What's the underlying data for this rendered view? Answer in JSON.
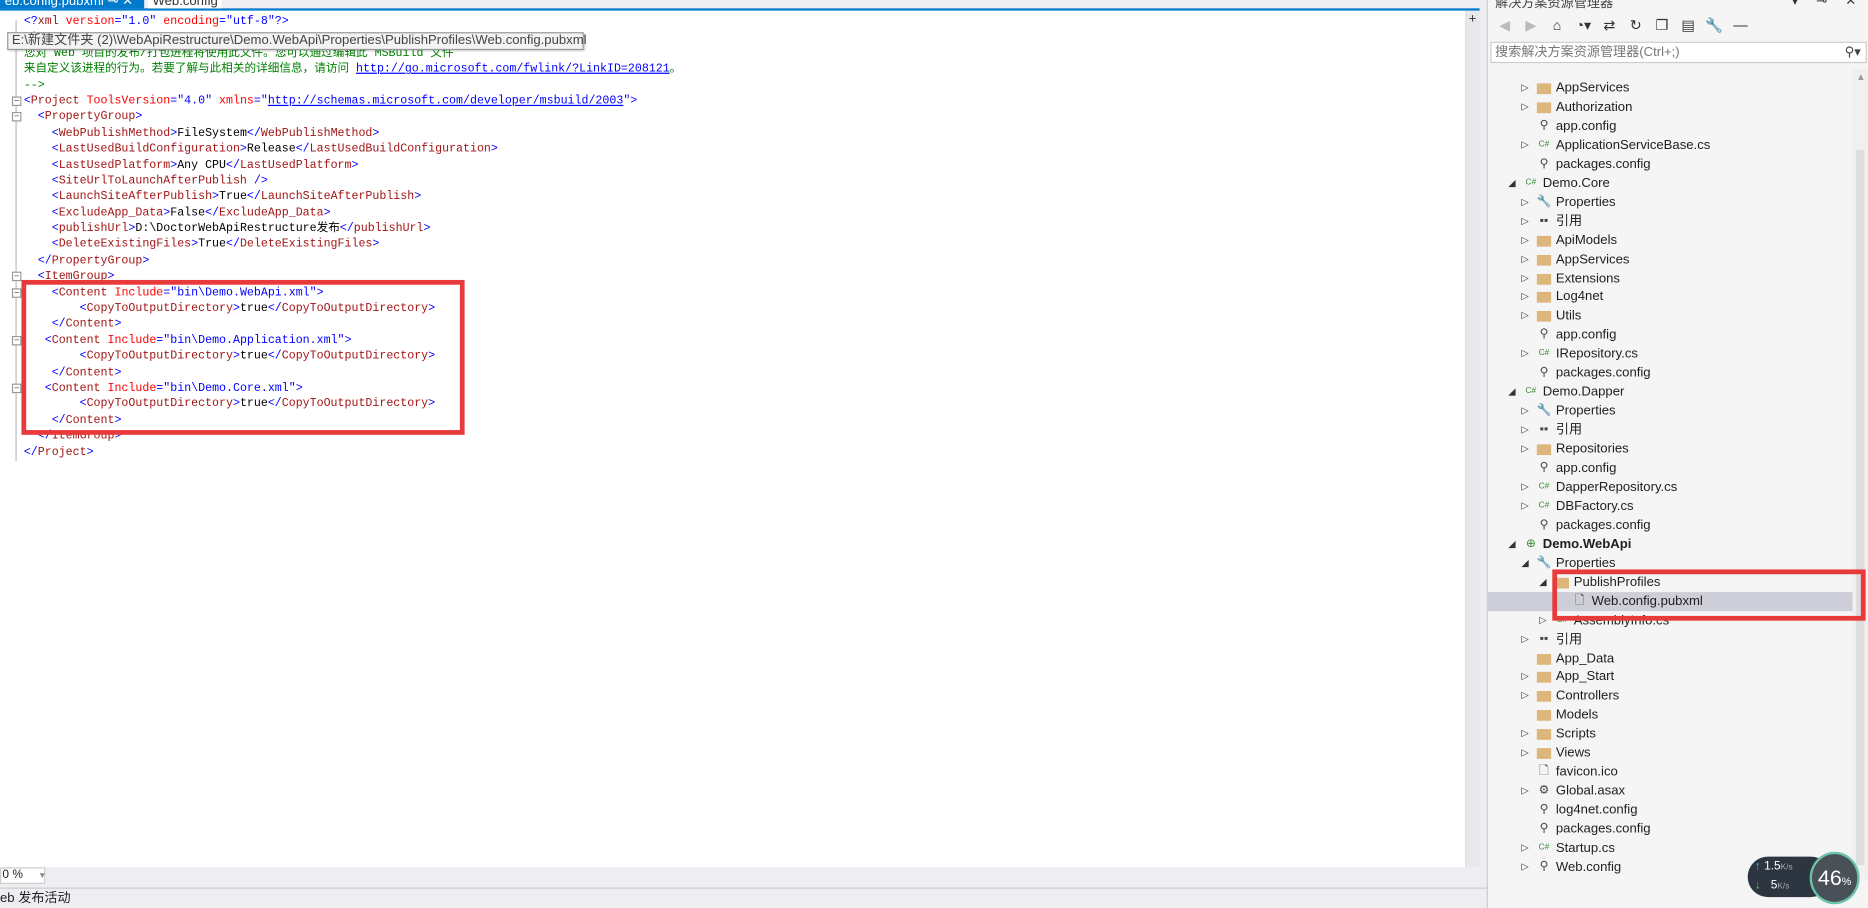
{
  "tabs": [
    {
      "label": "eb.config.pubxml",
      "active": true,
      "pin": "⊸",
      "close": "✕"
    },
    {
      "label": "Web.config",
      "active": false
    }
  ],
  "tooltip": "E:\\新建文件夹 (2)\\WebApiRestructure\\Demo.WebApi\\Properties\\PublishProfiles\\Web.config.pubxml",
  "code_lines": [
    [
      [
        "pb",
        "<?"
      ],
      [
        "el",
        "xml"
      ],
      [
        "at",
        " version"
      ],
      [
        "pb",
        "=\"1.0\""
      ],
      [
        "at",
        " encoding"
      ],
      [
        "pb",
        "=\"utf-8\"?>"
      ]
    ],
    [
      [
        "cm",
        "<!--"
      ]
    ],
    [
      [
        "cm",
        "您对 Web 项目的发布/打包进程将使用此文件。您可以通过编辑此 MSBuild 文件"
      ]
    ],
    [
      [
        "cm",
        "来自定义该进程的行为。若要了解与此相关的详细信息，请访问 "
      ],
      [
        "ln",
        "http://go.microsoft.com/fwlink/?LinkID=208121"
      ],
      [
        "cm",
        "。"
      ]
    ],
    [
      [
        "cm",
        "-->"
      ]
    ],
    [
      [
        "pb",
        "<"
      ],
      [
        "el",
        "Project"
      ],
      [
        "at",
        " ToolsVersion"
      ],
      [
        "pb",
        "=\"4.0\""
      ],
      [
        "at",
        " xmlns"
      ],
      [
        "pb",
        "=\""
      ],
      [
        "ln",
        "http://schemas.microsoft.com/developer/msbuild/2003"
      ],
      [
        "pb",
        "\">"
      ]
    ],
    [
      [
        "tx",
        "  "
      ],
      [
        "pb",
        "<"
      ],
      [
        "el",
        "PropertyGroup"
      ],
      [
        "pb",
        ">"
      ]
    ],
    [
      [
        "tx",
        "    "
      ],
      [
        "pb",
        "<"
      ],
      [
        "el",
        "WebPublishMethod"
      ],
      [
        "pb",
        ">"
      ],
      [
        "tx",
        "FileSystem"
      ],
      [
        "pb",
        "</"
      ],
      [
        "el",
        "WebPublishMethod"
      ],
      [
        "pb",
        ">"
      ]
    ],
    [
      [
        "tx",
        "    "
      ],
      [
        "pb",
        "<"
      ],
      [
        "el",
        "LastUsedBuildConfiguration"
      ],
      [
        "pb",
        ">"
      ],
      [
        "tx",
        "Release"
      ],
      [
        "pb",
        "</"
      ],
      [
        "el",
        "LastUsedBuildConfiguration"
      ],
      [
        "pb",
        ">"
      ]
    ],
    [
      [
        "tx",
        "    "
      ],
      [
        "pb",
        "<"
      ],
      [
        "el",
        "LastUsedPlatform"
      ],
      [
        "pb",
        ">"
      ],
      [
        "tx",
        "Any CPU"
      ],
      [
        "pb",
        "</"
      ],
      [
        "el",
        "LastUsedPlatform"
      ],
      [
        "pb",
        ">"
      ]
    ],
    [
      [
        "tx",
        "    "
      ],
      [
        "pb",
        "<"
      ],
      [
        "el",
        "SiteUrlToLaunchAfterPublish"
      ],
      [
        "pb",
        " />"
      ]
    ],
    [
      [
        "tx",
        "    "
      ],
      [
        "pb",
        "<"
      ],
      [
        "el",
        "LaunchSiteAfterPublish"
      ],
      [
        "pb",
        ">"
      ],
      [
        "tx",
        "True"
      ],
      [
        "pb",
        "</"
      ],
      [
        "el",
        "LaunchSiteAfterPublish"
      ],
      [
        "pb",
        ">"
      ]
    ],
    [
      [
        "tx",
        "    "
      ],
      [
        "pb",
        "<"
      ],
      [
        "el",
        "ExcludeApp_Data"
      ],
      [
        "pb",
        ">"
      ],
      [
        "tx",
        "False"
      ],
      [
        "pb",
        "</"
      ],
      [
        "el",
        "ExcludeApp_Data"
      ],
      [
        "pb",
        ">"
      ]
    ],
    [
      [
        "tx",
        "    "
      ],
      [
        "pb",
        "<"
      ],
      [
        "el",
        "publishUrl"
      ],
      [
        "pb",
        ">"
      ],
      [
        "tx",
        "D:\\DoctorWebApiRestructure发布"
      ],
      [
        "pb",
        "</"
      ],
      [
        "el",
        "publishUrl"
      ],
      [
        "pb",
        ">"
      ]
    ],
    [
      [
        "tx",
        "    "
      ],
      [
        "pb",
        "<"
      ],
      [
        "el",
        "DeleteExistingFiles"
      ],
      [
        "pb",
        ">"
      ],
      [
        "tx",
        "True"
      ],
      [
        "pb",
        "</"
      ],
      [
        "el",
        "DeleteExistingFiles"
      ],
      [
        "pb",
        ">"
      ]
    ],
    [
      [
        "tx",
        "  "
      ],
      [
        "pb",
        "</"
      ],
      [
        "el",
        "PropertyGroup"
      ],
      [
        "pb",
        ">"
      ]
    ],
    [
      [
        "tx",
        "  "
      ],
      [
        "pb",
        "<"
      ],
      [
        "el",
        "ItemGroup"
      ],
      [
        "pb",
        ">"
      ]
    ],
    [
      [
        "tx",
        "    "
      ],
      [
        "pb",
        "<"
      ],
      [
        "el",
        "Content"
      ],
      [
        "at",
        " Include"
      ],
      [
        "pb",
        "=\"bin\\Demo.WebApi.xml\">"
      ]
    ],
    [
      [
        "tx",
        "        "
      ],
      [
        "pb",
        "<"
      ],
      [
        "el",
        "CopyToOutputDirectory"
      ],
      [
        "pb",
        ">"
      ],
      [
        "tx",
        "true"
      ],
      [
        "pb",
        "</"
      ],
      [
        "el",
        "CopyToOutputDirectory"
      ],
      [
        "pb",
        ">"
      ]
    ],
    [
      [
        "tx",
        "    "
      ],
      [
        "pb",
        "</"
      ],
      [
        "el",
        "Content"
      ],
      [
        "pb",
        ">"
      ]
    ],
    [
      [
        "tx",
        "   "
      ],
      [
        "pb",
        "<"
      ],
      [
        "el",
        "Content"
      ],
      [
        "at",
        " Include"
      ],
      [
        "pb",
        "=\"bin\\Demo.Application.xml\">"
      ]
    ],
    [
      [
        "tx",
        "        "
      ],
      [
        "pb",
        "<"
      ],
      [
        "el",
        "CopyToOutputDirectory"
      ],
      [
        "pb",
        ">"
      ],
      [
        "tx",
        "true"
      ],
      [
        "pb",
        "</"
      ],
      [
        "el",
        "CopyToOutputDirectory"
      ],
      [
        "pb",
        ">"
      ]
    ],
    [
      [
        "tx",
        "    "
      ],
      [
        "pb",
        "</"
      ],
      [
        "el",
        "Content"
      ],
      [
        "pb",
        ">"
      ]
    ],
    [
      [
        "tx",
        "   "
      ],
      [
        "pb",
        "<"
      ],
      [
        "el",
        "Content"
      ],
      [
        "at",
        " Include"
      ],
      [
        "pb",
        "=\"bin\\Demo.Core.xml\">"
      ]
    ],
    [
      [
        "tx",
        "        "
      ],
      [
        "pb",
        "<"
      ],
      [
        "el",
        "CopyToOutputDirectory"
      ],
      [
        "pb",
        ">"
      ],
      [
        "tx",
        "true"
      ],
      [
        "pb",
        "</"
      ],
      [
        "el",
        "CopyToOutputDirectory"
      ],
      [
        "pb",
        ">"
      ]
    ],
    [
      [
        "tx",
        "    "
      ],
      [
        "pb",
        "</"
      ],
      [
        "el",
        "Content"
      ],
      [
        "pb",
        ">"
      ]
    ],
    [
      [
        "tx",
        "  "
      ],
      [
        "pb",
        "</"
      ],
      [
        "el",
        "ItemGroup"
      ],
      [
        "pb",
        ">"
      ]
    ],
    [
      [
        "pb",
        "</"
      ],
      [
        "el",
        "Project"
      ],
      [
        "pb",
        ">"
      ]
    ]
  ],
  "editor": {
    "zoom": "0 %",
    "split_icon": "+"
  },
  "status": {
    "text": "eb 发布活动"
  },
  "solution_explorer": {
    "title": "解决方案资源管理器",
    "title_buttons": "▾ ⊸ ✕",
    "search_placeholder": "搜索解决方案资源管理器(Ctrl+;)",
    "toolbar": [
      "back-icon",
      "forward-icon",
      "home-icon",
      "history-icon",
      "sync-icon",
      "refresh-icon",
      "collapse-all-icon",
      "show-all-files-icon",
      "properties-icon",
      "preview-icon"
    ],
    "items": [
      {
        "label": "AppServices",
        "level": 1,
        "icon": "folder",
        "exp": "closed"
      },
      {
        "label": "Authorization",
        "level": 1,
        "icon": "folder",
        "exp": "closed"
      },
      {
        "label": "app.config",
        "level": 1,
        "icon": "config"
      },
      {
        "label": "ApplicationServiceBase.cs",
        "level": 1,
        "icon": "cs",
        "exp": "closed"
      },
      {
        "label": "packages.config",
        "level": 1,
        "icon": "config"
      },
      {
        "label": "Demo.Core",
        "level": 0,
        "icon": "csproj",
        "exp": "open"
      },
      {
        "label": "Properties",
        "level": 1,
        "icon": "wrench",
        "exp": "closed"
      },
      {
        "label": "引用",
        "level": 1,
        "icon": "ref",
        "exp": "closed"
      },
      {
        "label": "ApiModels",
        "level": 1,
        "icon": "folder",
        "exp": "closed"
      },
      {
        "label": "AppServices",
        "level": 1,
        "icon": "folder",
        "exp": "closed"
      },
      {
        "label": "Extensions",
        "level": 1,
        "icon": "folder",
        "exp": "closed"
      },
      {
        "label": "Log4net",
        "level": 1,
        "icon": "folder",
        "exp": "closed"
      },
      {
        "label": "Utils",
        "level": 1,
        "icon": "folder",
        "exp": "closed"
      },
      {
        "label": "app.config",
        "level": 1,
        "icon": "config"
      },
      {
        "label": "IRepository.cs",
        "level": 1,
        "icon": "cs",
        "exp": "closed"
      },
      {
        "label": "packages.config",
        "level": 1,
        "icon": "config"
      },
      {
        "label": "Demo.Dapper",
        "level": 0,
        "icon": "csproj",
        "exp": "open"
      },
      {
        "label": "Properties",
        "level": 1,
        "icon": "wrench",
        "exp": "closed"
      },
      {
        "label": "引用",
        "level": 1,
        "icon": "ref",
        "exp": "closed"
      },
      {
        "label": "Repositories",
        "level": 1,
        "icon": "folder",
        "exp": "closed"
      },
      {
        "label": "app.config",
        "level": 1,
        "icon": "config"
      },
      {
        "label": "DapperRepository.cs",
        "level": 1,
        "icon": "cs",
        "exp": "closed"
      },
      {
        "label": "DBFactory.cs",
        "level": 1,
        "icon": "cs",
        "exp": "closed"
      },
      {
        "label": "packages.config",
        "level": 1,
        "icon": "config"
      },
      {
        "label": "Demo.WebApi",
        "level": 0,
        "icon": "web",
        "exp": "open",
        "bold": true
      },
      {
        "label": "Properties",
        "level": 1,
        "icon": "wrench",
        "exp": "open"
      },
      {
        "label": "PublishProfiles",
        "level": 2,
        "icon": "folder",
        "exp": "open"
      },
      {
        "label": "Web.config.pubxml",
        "level": 3,
        "icon": "file",
        "selected": true
      },
      {
        "label": "AssemblyInfo.cs",
        "level": 2,
        "icon": "cs",
        "exp": "closed"
      },
      {
        "label": "引用",
        "level": 1,
        "icon": "ref",
        "exp": "closed"
      },
      {
        "label": "App_Data",
        "level": 1,
        "icon": "folder"
      },
      {
        "label": "App_Start",
        "level": 1,
        "icon": "folder",
        "exp": "closed"
      },
      {
        "label": "Controllers",
        "level": 1,
        "icon": "folder",
        "exp": "closed"
      },
      {
        "label": "Models",
        "level": 1,
        "icon": "folder"
      },
      {
        "label": "Scripts",
        "level": 1,
        "icon": "folder",
        "exp": "closed"
      },
      {
        "label": "Views",
        "level": 1,
        "icon": "folder",
        "exp": "closed"
      },
      {
        "label": "favicon.ico",
        "level": 1,
        "icon": "file"
      },
      {
        "label": "Global.asax",
        "level": 1,
        "icon": "asax",
        "exp": "closed"
      },
      {
        "label": "log4net.config",
        "level": 1,
        "icon": "config"
      },
      {
        "label": "packages.config",
        "level": 1,
        "icon": "config"
      },
      {
        "label": "Startup.cs",
        "level": 1,
        "icon": "cs",
        "exp": "closed"
      },
      {
        "label": "Web.config",
        "level": 1,
        "icon": "config",
        "exp": "closed"
      }
    ]
  },
  "network_widget": {
    "upload": "1.5",
    "upload_unit": "K/s",
    "download": "5",
    "download_unit": "K/s",
    "percent": "46",
    "percent_sign": "%"
  },
  "colors": {
    "accent": "#007acc",
    "highlight": "#e83a3a",
    "selection": "#cdced7"
  }
}
